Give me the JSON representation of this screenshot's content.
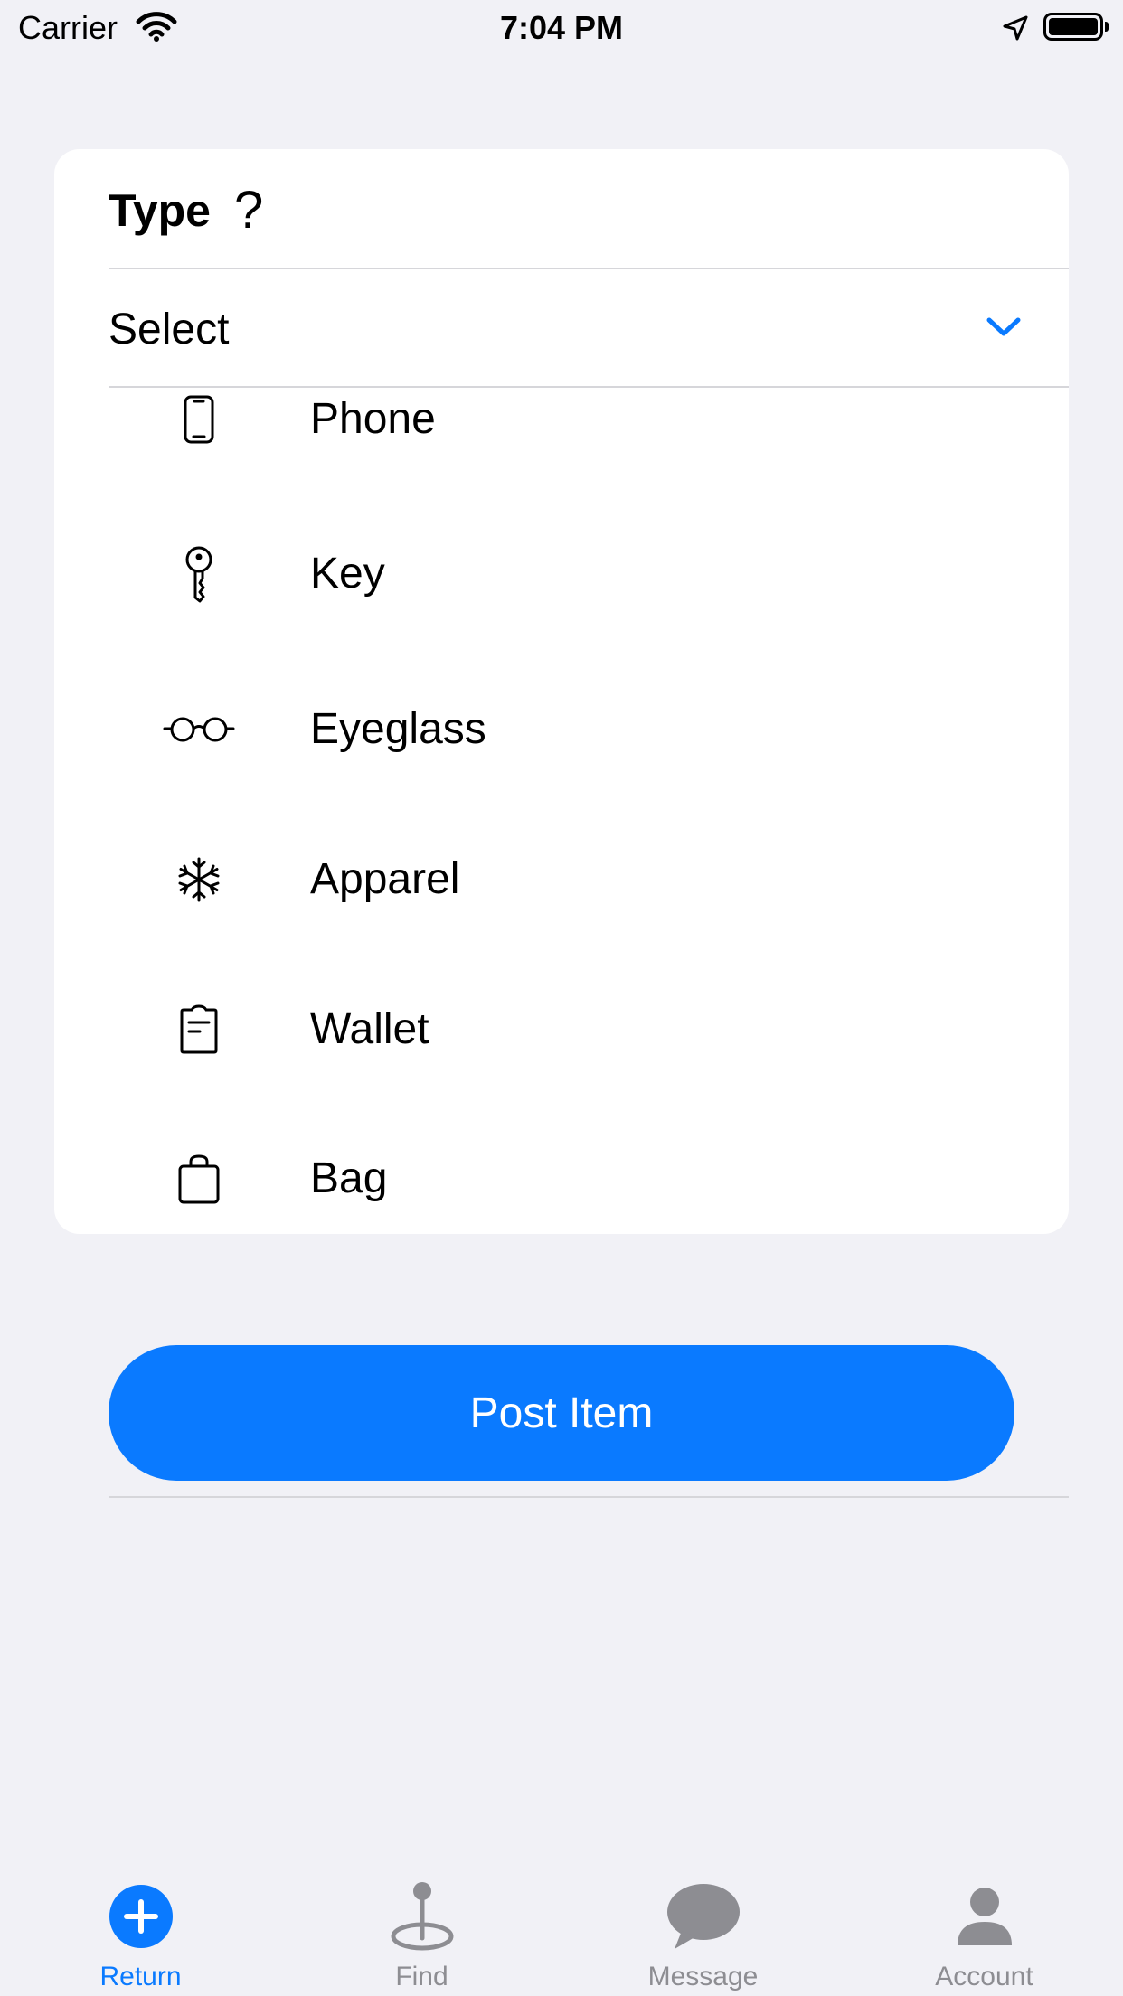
{
  "status_bar": {
    "carrier": "Carrier",
    "time": "7:04 PM"
  },
  "card": {
    "title": "Type",
    "help_glyph": "?",
    "select_placeholder": "Select",
    "options": [
      {
        "label": "Phone",
        "icon": "phone-icon"
      },
      {
        "label": "Key",
        "icon": "key-icon"
      },
      {
        "label": "Eyeglass",
        "icon": "eyeglasses-icon"
      },
      {
        "label": "Apparel",
        "icon": "snowflake-icon"
      },
      {
        "label": "Wallet",
        "icon": "wallet-icon"
      },
      {
        "label": "Bag",
        "icon": "bag-icon"
      }
    ]
  },
  "post_button": {
    "label": "Post Item"
  },
  "tabs": [
    {
      "label": "Return",
      "icon": "plus-circle-icon",
      "active": true
    },
    {
      "label": "Find",
      "icon": "pin-icon",
      "active": false
    },
    {
      "label": "Message",
      "icon": "chat-bubble-icon",
      "active": false
    },
    {
      "label": "Account",
      "icon": "person-icon",
      "active": false
    }
  ],
  "colors": {
    "accent": "#0a7aff",
    "background": "#f1f1f6",
    "inactive_tab": "#8d8d92"
  }
}
